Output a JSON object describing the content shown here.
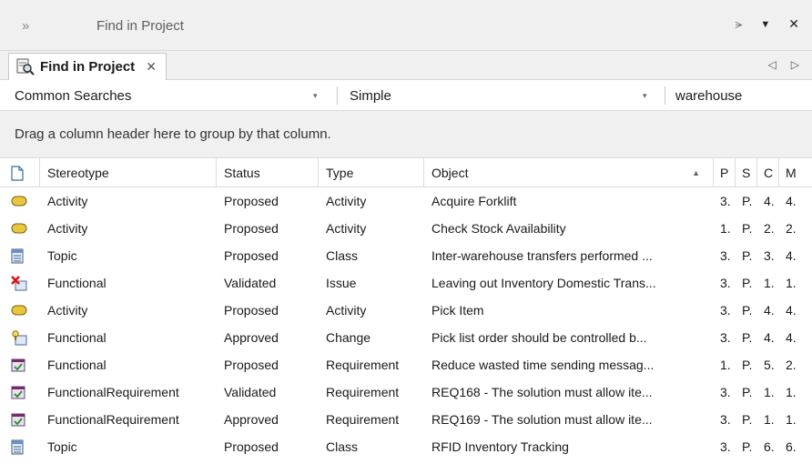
{
  "window": {
    "title": "Find in Project",
    "collapse_glyph": "»",
    "buttons": [
      "⪫",
      "▼",
      "✕"
    ]
  },
  "tab": {
    "label": "Find in Project",
    "close_glyph": "✕",
    "icon": "find-in-project-icon",
    "nav_prev": "◁",
    "nav_next": "▷"
  },
  "search": {
    "category": "Common Searches",
    "mode": "Simple",
    "term": "warehouse",
    "dropdown_glyph": "▾"
  },
  "group_hint": "Drag a column header here to group by that column.",
  "columns": {
    "icon": "document-icon",
    "stereotype": "Stereotype",
    "status": "Status",
    "type": "Type",
    "object": "Object",
    "sort_glyph": "▲",
    "p": "P",
    "s": "S",
    "c": "C",
    "m": "M"
  },
  "rows": [
    {
      "icon": "activity-icon",
      "stereotype": "Activity",
      "status": "Proposed",
      "type": "Activity",
      "object": "Acquire Forklift",
      "p": "3.",
      "s": "P.",
      "c": "4.",
      "m": "4."
    },
    {
      "icon": "activity-icon",
      "stereotype": "Activity",
      "status": "Proposed",
      "type": "Activity",
      "object": "Check Stock Availability",
      "p": "1.",
      "s": "P.",
      "c": "2.",
      "m": "2."
    },
    {
      "icon": "topic-icon",
      "stereotype": "Topic",
      "status": "Proposed",
      "type": "Class",
      "object": "Inter-warehouse transfers performed ...",
      "p": "3.",
      "s": "P.",
      "c": "3.",
      "m": "4."
    },
    {
      "icon": "issue-icon",
      "stereotype": "Functional",
      "status": "Validated",
      "type": "Issue",
      "object": "Leaving out Inventory Domestic Trans...",
      "p": "3.",
      "s": "P.",
      "c": "1.",
      "m": "1."
    },
    {
      "icon": "activity-icon",
      "stereotype": "Activity",
      "status": "Proposed",
      "type": "Activity",
      "object": "Pick Item",
      "p": "3.",
      "s": "P.",
      "c": "4.",
      "m": "4."
    },
    {
      "icon": "change-icon",
      "stereotype": "Functional",
      "status": "Approved",
      "type": "Change",
      "object": "Pick list order should be controlled b...",
      "p": "3.",
      "s": "P.",
      "c": "4.",
      "m": "4."
    },
    {
      "icon": "requirement-icon",
      "stereotype": "Functional",
      "status": "Proposed",
      "type": "Requirement",
      "object": "Reduce wasted time sending messag...",
      "p": "1.",
      "s": "P.",
      "c": "5.",
      "m": "2."
    },
    {
      "icon": "requirement-icon",
      "stereotype": "FunctionalRequirement",
      "status": "Validated",
      "type": "Requirement",
      "object": "REQ168 - The solution must allow ite...",
      "p": "3.",
      "s": "P.",
      "c": "1.",
      "m": "1."
    },
    {
      "icon": "requirement-icon",
      "stereotype": "FunctionalRequirement",
      "status": "Approved",
      "type": "Requirement",
      "object": "REQ169 - The solution must allow ite...",
      "p": "3.",
      "s": "P.",
      "c": "1.",
      "m": "1."
    },
    {
      "icon": "topic-icon",
      "stereotype": "Topic",
      "status": "Proposed",
      "type": "Class",
      "object": "RFID Inventory Tracking",
      "p": "3.",
      "s": "P.",
      "c": "6.",
      "m": "6."
    }
  ]
}
